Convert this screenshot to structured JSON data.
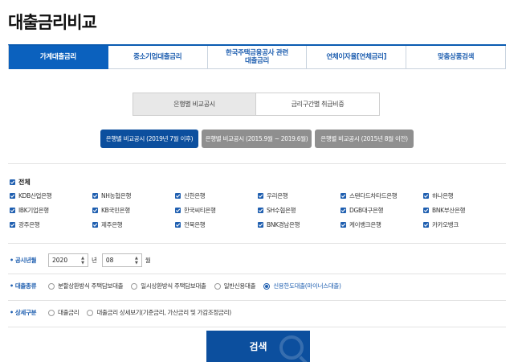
{
  "page": {
    "title": "대출금리비교"
  },
  "main_tabs": [
    {
      "label": "가계대출금리",
      "active": true
    },
    {
      "label": "중소기업대출금리",
      "active": false
    },
    {
      "label": "한국주택금융공사 관련\n대출금리",
      "active": false
    },
    {
      "label": "연체이자율[연체금리]",
      "active": false
    },
    {
      "label": "맞춤상품검색",
      "active": false
    }
  ],
  "sub_toggle": [
    {
      "label": "은행별 비교공시",
      "active": true
    },
    {
      "label": "금리구간별 취급비중",
      "active": false
    }
  ],
  "periods": [
    {
      "label": "은행별 비교공시 (2019년 7월 이후)",
      "active": true
    },
    {
      "label": "은행별 비교공시 (2015.9월 ~ 2019.6월)",
      "active": false
    },
    {
      "label": "은행별 비교공시 (2015년 8월 이전)",
      "active": false
    }
  ],
  "banks": {
    "all_label": "전체",
    "items": [
      "KDB산업은행",
      "NH농협은행",
      "신한은행",
      "우리은행",
      "스탠다드차타드은행",
      "하나은행",
      "IBK기업은행",
      "KB국민은행",
      "한국씨티은행",
      "SH수협은행",
      "DGB대구은행",
      "BNK부산은행",
      "광주은행",
      "제주은행",
      "전북은행",
      "BNK경남은행",
      "케이뱅크은행",
      "카카오뱅크"
    ]
  },
  "form": {
    "date_label": "공시년월",
    "year_value": "2020",
    "year_unit": "년",
    "month_value": "08",
    "month_unit": "월",
    "loan_type_label": "대출종류",
    "loan_types": [
      {
        "label": "분할상환방식 주택담보대출",
        "selected": false
      },
      {
        "label": "일시상환방식 주택담보대출",
        "selected": false
      },
      {
        "label": "일반신용대출",
        "selected": false
      },
      {
        "label": "신용한도대출(마이너스대출)",
        "selected": true
      }
    ],
    "detail_label": "상세구분",
    "detail_types": [
      {
        "label": "대출금리",
        "selected": false
      },
      {
        "label": "대출금리 상세보기(기준금리, 가산금리 및 가감조정금리)",
        "selected": false
      }
    ]
  },
  "search": {
    "label": "검색"
  },
  "colors": {
    "primary": "#0b61be",
    "dark": "#0c4f9e",
    "inactive": "#8f8f8f",
    "accent_text": "#1f5fb0"
  },
  "icons": {
    "bullet": "•",
    "select_arrow": "▲▼"
  }
}
